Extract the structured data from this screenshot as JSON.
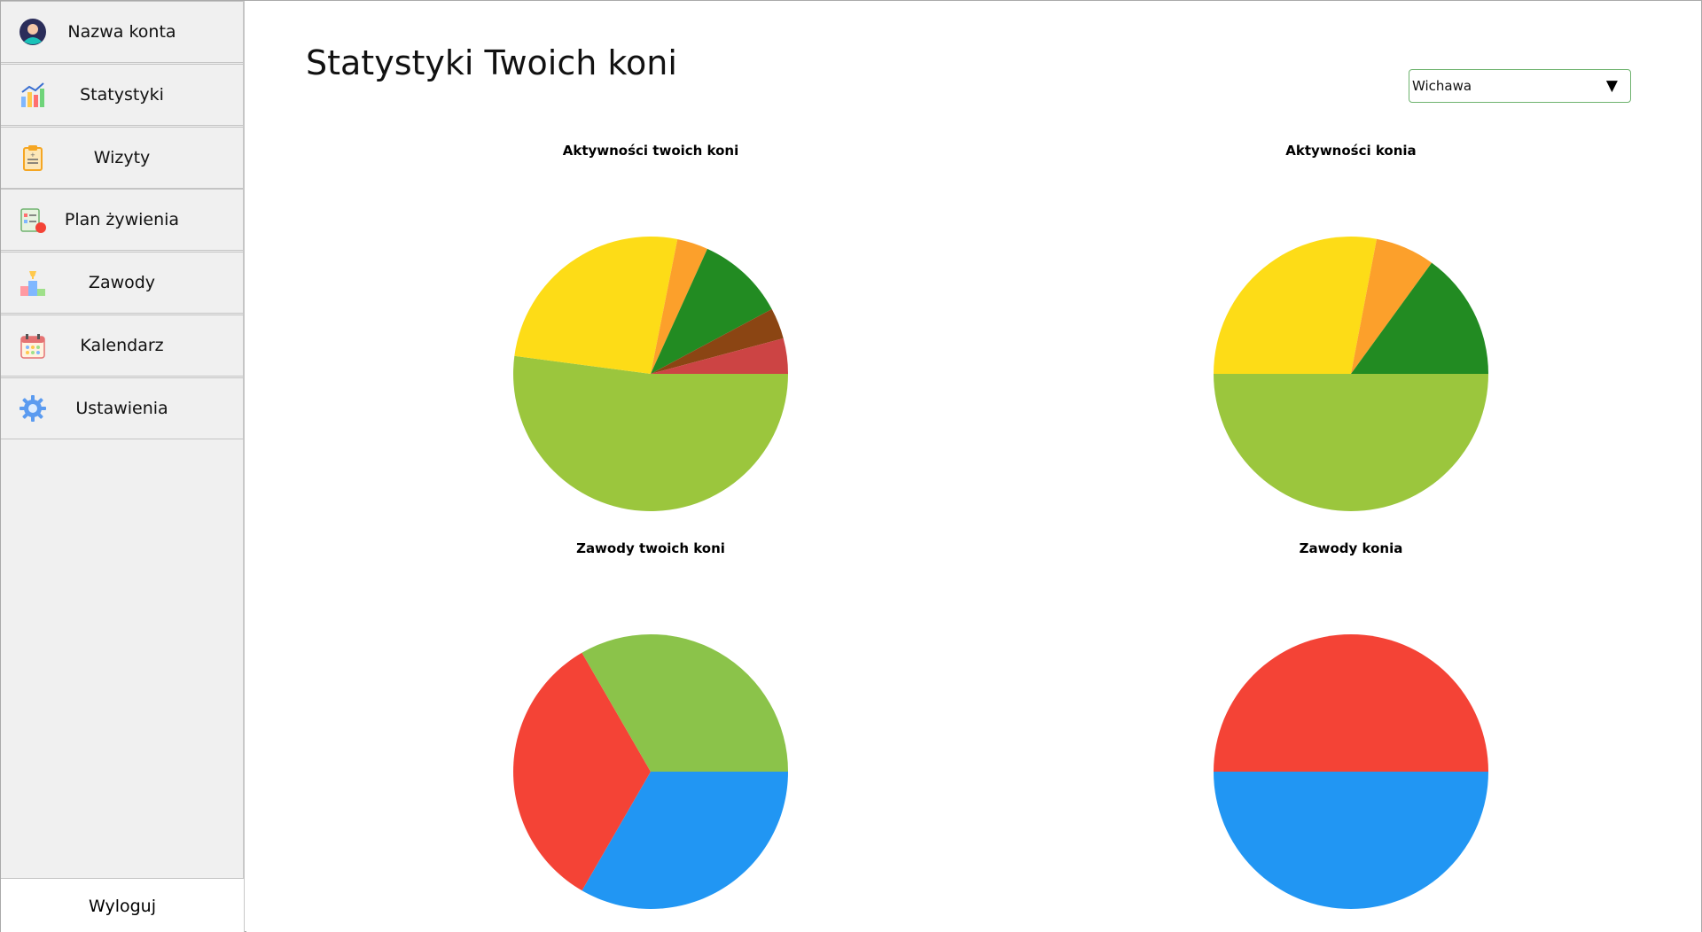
{
  "sidebar": {
    "items": [
      {
        "label": "Nazwa konta",
        "icon": "user-avatar-icon"
      },
      {
        "label": "Statystyki",
        "icon": "bar-chart-icon"
      },
      {
        "label": "Wizyty",
        "icon": "clipboard-icon"
      },
      {
        "label": "Plan żywienia",
        "icon": "diet-plan-icon"
      },
      {
        "label": "Zawody",
        "icon": "podium-icon"
      },
      {
        "label": "Kalendarz",
        "icon": "calendar-icon"
      },
      {
        "label": "Ustawienia",
        "icon": "gear-icon"
      }
    ],
    "logout_label": "Wyloguj"
  },
  "main": {
    "title": "Statystyki Twoich koni",
    "horse_select": {
      "value": "Wichawa",
      "caret": "▼"
    }
  },
  "colors": {
    "yellowgreen": "#9BC63D",
    "gold": "#FDDC17",
    "orange": "#FCA02B",
    "green": "#228B22",
    "brown": "#8B4513",
    "red_brown": "#CC4444",
    "red": "#F44336",
    "light_green": "#8BC34A",
    "blue": "#2196F3"
  },
  "chart_data": [
    {
      "type": "pie",
      "title": "Aktywności twoich koni",
      "values": [
        50,
        25,
        3.5,
        10,
        3.5,
        4
      ],
      "colors": [
        "#9BC63D",
        "#FDDC17",
        "#FCA02B",
        "#228B22",
        "#8B4513",
        "#CC4444"
      ]
    },
    {
      "type": "pie",
      "title": "Aktywności konia",
      "values": [
        50,
        28,
        7,
        15
      ],
      "colors": [
        "#9BC63D",
        "#FDDC17",
        "#FCA02B",
        "#228B22"
      ]
    },
    {
      "type": "pie",
      "title": "Zawody twoich koni",
      "values": [
        33.33,
        33.33,
        33.34
      ],
      "colors": [
        "#2196F3",
        "#F44336",
        "#8BC34A"
      ]
    },
    {
      "type": "pie",
      "title": "Zawody konia",
      "values": [
        50,
        50
      ],
      "colors": [
        "#2196F3",
        "#F44336"
      ]
    }
  ]
}
